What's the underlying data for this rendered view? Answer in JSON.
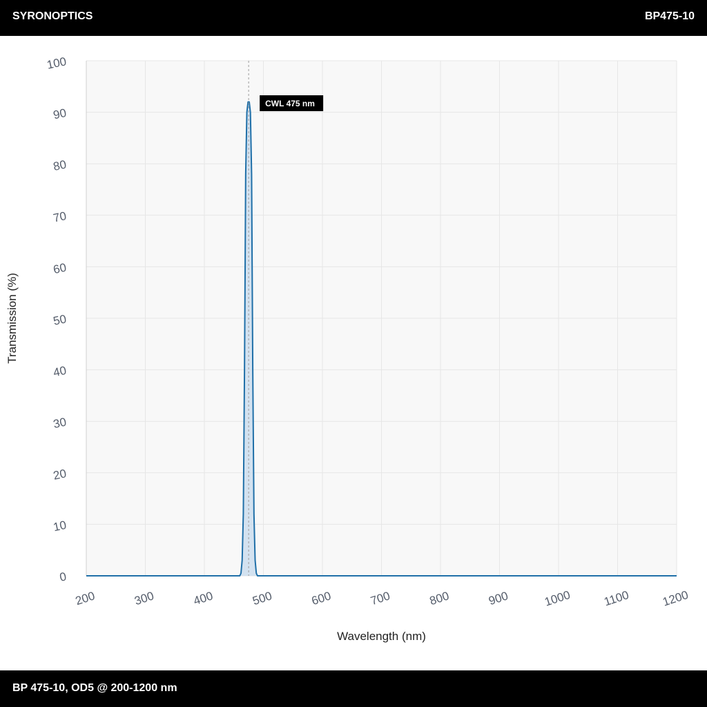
{
  "header": {
    "brand": "SYRONOPTICS",
    "model": "BP475-10"
  },
  "footer": {
    "caption": "BP 475-10, OD5 @ 200-1200 nm"
  },
  "colors": {
    "bars": "#000000",
    "line": "#1f6fa8",
    "fill": "#c9dced",
    "grid": "#e6e6e6",
    "plot_bg": "#f8f8f8",
    "tick_text": "#555d6b"
  },
  "chart_data": {
    "type": "line",
    "xlabel": "Wavelength (nm)",
    "ylabel": "Transmission (%)",
    "xlim": [
      200,
      1200
    ],
    "ylim": [
      0,
      100
    ],
    "x_ticks": [
      200,
      300,
      400,
      500,
      600,
      700,
      800,
      900,
      1000,
      1100,
      1200
    ],
    "y_ticks": [
      0,
      10,
      20,
      30,
      40,
      50,
      60,
      70,
      80,
      90,
      100
    ],
    "grid": true,
    "legend": "none",
    "series": [
      {
        "x": [
          200,
          460,
          462,
          464,
          466,
          468,
          470,
          472,
          474,
          475,
          476,
          478,
          480,
          482,
          484,
          486,
          488,
          490,
          1200
        ],
        "y": [
          0,
          0,
          0.5,
          3,
          12,
          40,
          78,
          90,
          92,
          92,
          92,
          90,
          78,
          40,
          12,
          3,
          0.5,
          0,
          0
        ]
      }
    ],
    "annotations": [
      {
        "x": 475,
        "label": "CWL 475 nm"
      }
    ]
  }
}
